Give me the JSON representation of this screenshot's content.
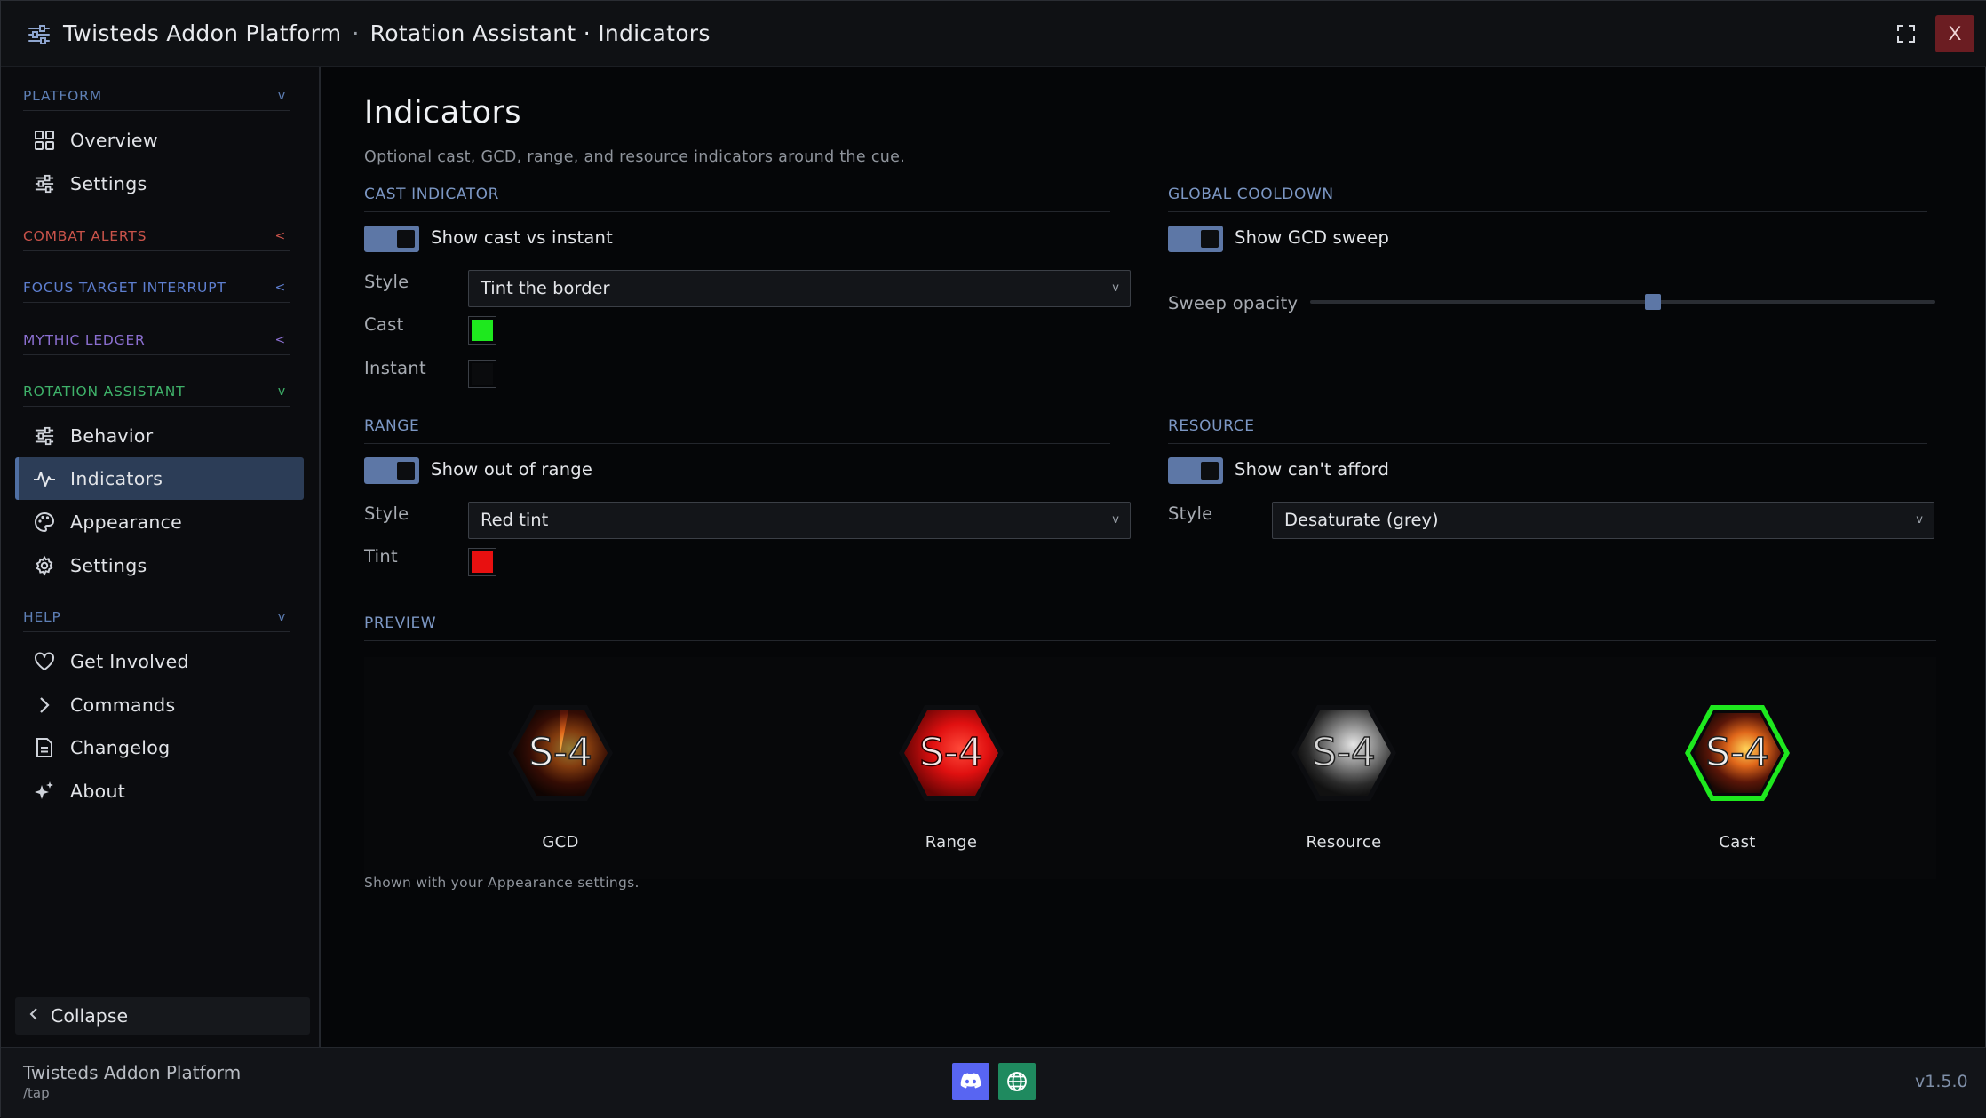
{
  "window": {
    "app_name": "Twisteds Addon Platform",
    "breadcrumb_sep": "·",
    "breadcrumb": "Rotation Assistant · Indicators",
    "maximize_icon": "fullscreen-icon",
    "close_label": "X"
  },
  "sidebar": {
    "sections": [
      {
        "label": "PLATFORM",
        "color": "#5e7fb5",
        "chevron": "v",
        "expanded": true,
        "items": [
          {
            "label": "Overview",
            "icon": "grid-icon"
          },
          {
            "label": "Settings",
            "icon": "sliders-icon"
          }
        ]
      },
      {
        "label": "COMBAT ALERTS",
        "color": "#c9534a",
        "chevron": "<",
        "expanded": false,
        "items": []
      },
      {
        "label": "FOCUS TARGET INTERRUPT",
        "color": "#5e7fd0",
        "chevron": "<",
        "expanded": false,
        "items": []
      },
      {
        "label": "MYTHIC LEDGER",
        "color": "#8b6fd0",
        "chevron": "<",
        "expanded": false,
        "items": []
      },
      {
        "label": "ROTATION ASSISTANT",
        "color": "#3fb26a",
        "chevron": "v",
        "expanded": true,
        "items": [
          {
            "label": "Behavior",
            "icon": "sliders-icon"
          },
          {
            "label": "Indicators",
            "icon": "pulse-icon",
            "active": true
          },
          {
            "label": "Appearance",
            "icon": "palette-icon"
          },
          {
            "label": "Settings",
            "icon": "gear-icon"
          }
        ]
      },
      {
        "label": "HELP",
        "color": "#5e7fb5",
        "chevron": "v",
        "expanded": true,
        "items": [
          {
            "label": "Get Involved",
            "icon": "heart-icon"
          },
          {
            "label": "Commands",
            "icon": "chevron-right-icon"
          },
          {
            "label": "Changelog",
            "icon": "document-icon"
          },
          {
            "label": "About",
            "icon": "sparkles-icon"
          }
        ]
      }
    ],
    "collapse_label": "Collapse"
  },
  "page": {
    "title": "Indicators",
    "subtitle": "Optional cast, GCD, range, and resource indicators around the cue."
  },
  "cast_indicator": {
    "heading": "CAST INDICATOR",
    "toggle_label": "Show cast vs instant",
    "toggle_on": true,
    "style_label": "Style",
    "style_value": "Tint the border",
    "cast_label": "Cast",
    "cast_color": "#1ee81e",
    "instant_label": "Instant",
    "instant_color": "#0a0b0d"
  },
  "global_cooldown": {
    "heading": "GLOBAL COOLDOWN",
    "toggle_label": "Show GCD sweep",
    "toggle_on": true,
    "opacity_label": "Sweep opacity",
    "opacity_value": 0.55
  },
  "range": {
    "heading": "RANGE",
    "toggle_label": "Show out of range",
    "toggle_on": true,
    "style_label": "Style",
    "style_value": "Red tint",
    "tint_label": "Tint",
    "tint_color": "#e81010"
  },
  "resource": {
    "heading": "RESOURCE",
    "toggle_label": "Show can't afford",
    "toggle_on": true,
    "style_label": "Style",
    "style_value": "Desaturate (grey)"
  },
  "preview": {
    "heading": "PREVIEW",
    "items": [
      {
        "label": "GCD",
        "badge": "S-4",
        "variant": "gcd"
      },
      {
        "label": "Range",
        "badge": "S-4",
        "variant": "range"
      },
      {
        "label": "Resource",
        "badge": "S-4",
        "variant": "resource"
      },
      {
        "label": "Cast",
        "badge": "S-4",
        "variant": "cast"
      }
    ],
    "note": "Shown with your Appearance settings."
  },
  "footer": {
    "app_name": "Twisteds Addon Platform",
    "command": "/tap",
    "discord_icon": "discord-icon",
    "web_icon": "globe-icon",
    "version": "v1.5.0"
  }
}
